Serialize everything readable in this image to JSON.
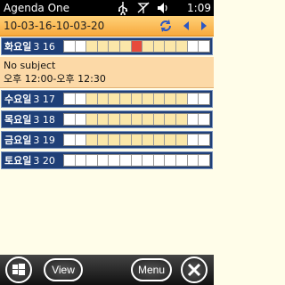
{
  "status_bar": {
    "app_title": "Agenda One",
    "time": "1:09",
    "icons": [
      "usb-icon",
      "signal-off-icon",
      "volume-icon"
    ]
  },
  "date_bar": {
    "range": "10-03-16-10-03-20",
    "nav_icons": [
      "sync-icon",
      "previous-arrow-icon",
      "next-arrow-icon"
    ]
  },
  "days": [
    {
      "weekday": "화요일",
      "date": "3 16"
    },
    {
      "weekday": "수요일",
      "date": "3 17"
    },
    {
      "weekday": "목요일",
      "date": "3 18"
    },
    {
      "weekday": "금요일",
      "date": "3 19"
    },
    {
      "weekday": "토요일",
      "date": "3 20"
    }
  ],
  "appointment": {
    "subject": "No subject",
    "time": "오후 12:00-오후 12:30"
  },
  "bottom_bar": {
    "view_label": "View",
    "menu_label": "Menu",
    "icons": [
      "windows-start-icon",
      "close-icon"
    ]
  },
  "colors": {
    "status_bar": "#000000",
    "date_bar": "#f7a93d",
    "day_header": "#1f3f77",
    "appointment": "#fcd9a7",
    "busy_slot": "#e74b3c",
    "work_slot": "#fbe7a9"
  }
}
